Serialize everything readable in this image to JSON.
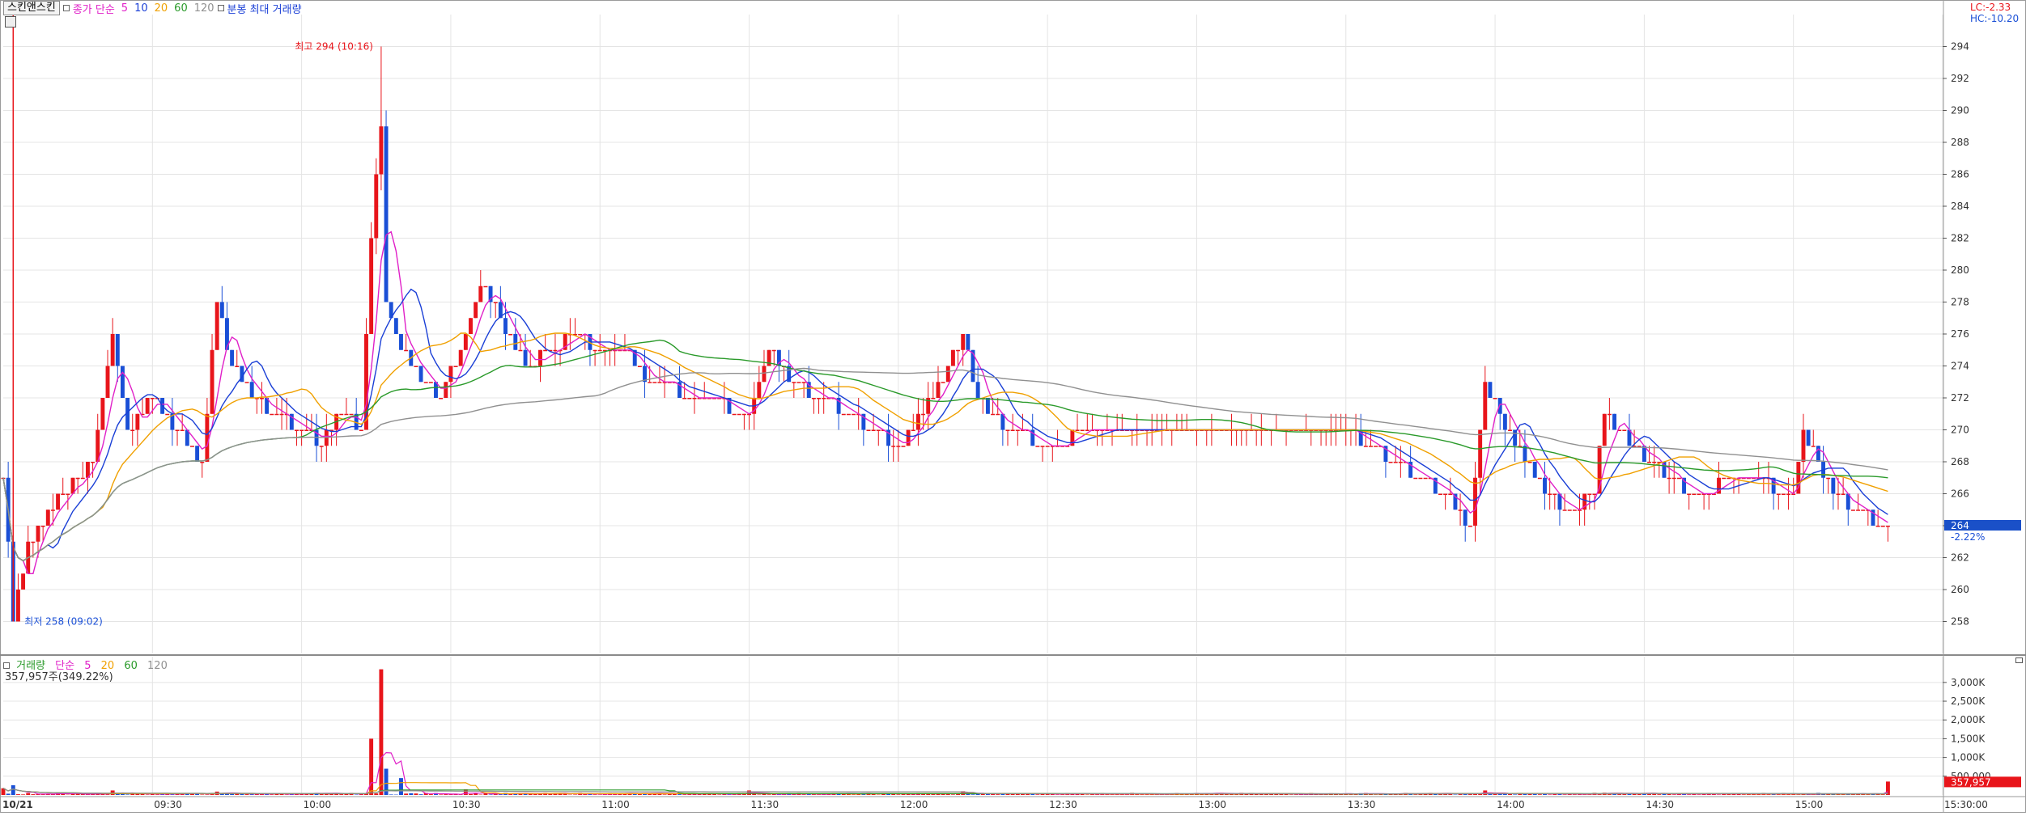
{
  "toolbar": {
    "stock_name": "스킨앤스킨",
    "ma_label": "종가 단순",
    "ma_periods": [
      "5",
      "10",
      "20",
      "60",
      "120"
    ],
    "extra_label": "분봉 최대 거래량"
  },
  "corner": {
    "lc": "LC:-2.33",
    "hc": "HC:-10.20"
  },
  "volume_header": {
    "label": "거래량",
    "ma_label": "단순",
    "ma_periods": [
      "5",
      "20",
      "60",
      "120"
    ],
    "info": "357,957주(349.22%)"
  },
  "colors": {
    "up": "#e8151b",
    "down": "#1a4fd6",
    "ma5": "#e020c8",
    "ma10": "#1a3fd6",
    "ma20": "#f0a000",
    "ma60": "#2a9a2a",
    "ma120": "#909090",
    "grid": "#e4e4e4",
    "axis_text": "#333333",
    "current_price_bg": "#1a50c8"
  },
  "chart_data": [
    {
      "type": "candlestick",
      "x_range": [
        "09:00",
        "15:30"
      ],
      "x_ticks": [
        "10/21",
        "09:30",
        "10:00",
        "10:30",
        "11:00",
        "11:30",
        "12:00",
        "12:30",
        "13:00",
        "13:30",
        "14:00",
        "14:30",
        "15:00",
        "15:30:00"
      ],
      "ylim": [
        256,
        296
      ],
      "y_ticks": [
        258,
        260,
        262,
        264,
        266,
        268,
        270,
        272,
        274,
        276,
        278,
        280,
        282,
        284,
        286,
        288,
        290,
        292,
        294
      ],
      "annotations": [
        {
          "label": "최고 294 (10:16)",
          "time": "10:16",
          "value": 294
        },
        {
          "label": "최저 258 (09:02)",
          "time": "09:02",
          "value": 258
        }
      ],
      "current_price": {
        "value": "264",
        "change": "-2.22%"
      },
      "price_path": [
        [
          "09:00",
          267
        ],
        [
          "09:02",
          258
        ],
        [
          "09:05",
          263
        ],
        [
          "09:08",
          264
        ],
        [
          "09:12",
          266
        ],
        [
          "09:18",
          268
        ],
        [
          "09:22",
          276
        ],
        [
          "09:25",
          270
        ],
        [
          "09:30",
          272
        ],
        [
          "09:35",
          270
        ],
        [
          "09:40",
          268
        ],
        [
          "09:43",
          278
        ],
        [
          "09:46",
          274
        ],
        [
          "09:50",
          272
        ],
        [
          "09:55",
          271
        ],
        [
          "10:00",
          270
        ],
        [
          "10:04",
          269
        ],
        [
          "10:08",
          271
        ],
        [
          "10:12",
          270
        ],
        [
          "10:14",
          282
        ],
        [
          "10:16",
          289
        ],
        [
          "10:17",
          278
        ],
        [
          "10:20",
          275
        ],
        [
          "10:24",
          273
        ],
        [
          "10:28",
          272
        ],
        [
          "10:33",
          276
        ],
        [
          "10:36",
          279
        ],
        [
          "10:40",
          277
        ],
        [
          "10:45",
          274
        ],
        [
          "10:50",
          275
        ],
        [
          "10:55",
          276
        ],
        [
          "11:00",
          275
        ],
        [
          "11:05",
          275
        ],
        [
          "11:10",
          273
        ],
        [
          "11:20",
          272
        ],
        [
          "11:30",
          271
        ],
        [
          "11:34",
          275
        ],
        [
          "11:38",
          273
        ],
        [
          "11:45",
          272
        ],
        [
          "11:55",
          270
        ],
        [
          "12:00",
          269
        ],
        [
          "12:05",
          271
        ],
        [
          "12:10",
          274
        ],
        [
          "12:13",
          276
        ],
        [
          "12:16",
          272
        ],
        [
          "12:22",
          270
        ],
        [
          "12:30",
          269
        ],
        [
          "12:40",
          270
        ],
        [
          "12:50",
          270
        ],
        [
          "13:00",
          270
        ],
        [
          "13:10",
          270
        ],
        [
          "13:20",
          270
        ],
        [
          "13:30",
          270
        ],
        [
          "13:40",
          268
        ],
        [
          "13:50",
          266
        ],
        [
          "13:55",
          264
        ],
        [
          "13:58",
          273
        ],
        [
          "14:02",
          270
        ],
        [
          "14:10",
          266
        ],
        [
          "14:15",
          265
        ],
        [
          "14:20",
          266
        ],
        [
          "14:22",
          271
        ],
        [
          "14:28",
          269
        ],
        [
          "14:35",
          267
        ],
        [
          "14:40",
          266
        ],
        [
          "14:50",
          267
        ],
        [
          "15:00",
          266
        ],
        [
          "15:02",
          270
        ],
        [
          "15:06",
          267
        ],
        [
          "15:12",
          265
        ],
        [
          "15:19",
          264
        ]
      ],
      "series": [
        {
          "name": "5",
          "color": "#e020c8"
        },
        {
          "name": "10",
          "color": "#1a3fd6"
        },
        {
          "name": "20",
          "color": "#f0a000"
        },
        {
          "name": "60",
          "color": "#2a9a2a"
        },
        {
          "name": "120",
          "color": "#909090"
        }
      ]
    },
    {
      "type": "bar",
      "x_range": [
        "09:00",
        "15:30"
      ],
      "ylim": [
        0,
        3600000
      ],
      "y_ticks": [
        "500,000",
        "1,000K",
        "1,500K",
        "2,000K",
        "2,500K",
        "3,000K"
      ],
      "current_volume": "357,957",
      "volume_peaks": [
        [
          "09:00",
          180000
        ],
        [
          "09:02",
          260000
        ],
        [
          "09:22",
          120000
        ],
        [
          "09:43",
          90000
        ],
        [
          "10:14",
          1500000
        ],
        [
          "10:16",
          3350000
        ],
        [
          "10:17",
          700000
        ],
        [
          "10:20",
          450000
        ],
        [
          "10:33",
          150000
        ],
        [
          "11:30",
          120000
        ],
        [
          "12:13",
          100000
        ],
        [
          "13:58",
          120000
        ],
        [
          "14:22",
          60000
        ],
        [
          "15:19",
          357957
        ]
      ],
      "base_volume": 30000
    }
  ]
}
